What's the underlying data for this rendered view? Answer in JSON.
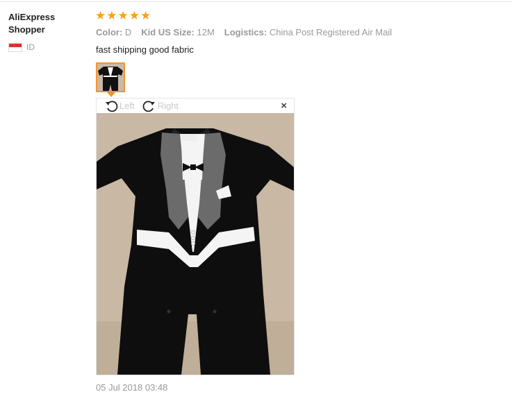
{
  "reviewer": {
    "name": "AliExpress Shopper",
    "country_code": "ID",
    "flag_colors": [
      "#e0312e",
      "#ffffff"
    ]
  },
  "rating": {
    "stars": 5,
    "max": 5,
    "star_color": "#f7a11a"
  },
  "attributes": [
    {
      "label": "Color:",
      "value": "D"
    },
    {
      "label": "Kid US Size:",
      "value": "12M"
    },
    {
      "label": "Logistics:",
      "value": "China Post Registered Air Mail"
    }
  ],
  "review_text": "fast shipping good fabric",
  "viewer": {
    "rotate_left_label": "Left",
    "rotate_right_label": "Right",
    "close_glyph": "×",
    "accent_color": "#f49433"
  },
  "date": "05 Jul 2018 03:48"
}
